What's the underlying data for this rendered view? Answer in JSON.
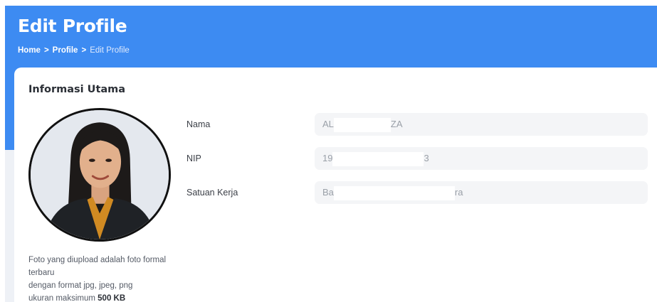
{
  "header": {
    "title": "Edit Profile",
    "breadcrumb": {
      "items": [
        "Home",
        "Profile"
      ],
      "separator": ">",
      "current": "Edit Profile"
    },
    "background_color": "#3d8bf2"
  },
  "section": {
    "title": "Informasi Utama"
  },
  "photo": {
    "alt": "profile-photo"
  },
  "note": {
    "line1": "Foto yang diupload adalah foto formal terbaru",
    "line2": "dengan format jpg, jpeg, png",
    "line3_prefix": "ukuran maksimum",
    "line3_size": "500 KB"
  },
  "fields": [
    {
      "label": "Nama",
      "value_start": "AL",
      "value_end": "ZA"
    },
    {
      "label": "NIP",
      "value_start": "19",
      "value_end": "3"
    },
    {
      "label": "Satuan Kerja",
      "value_start": "Ba",
      "value_end": "ra"
    }
  ]
}
